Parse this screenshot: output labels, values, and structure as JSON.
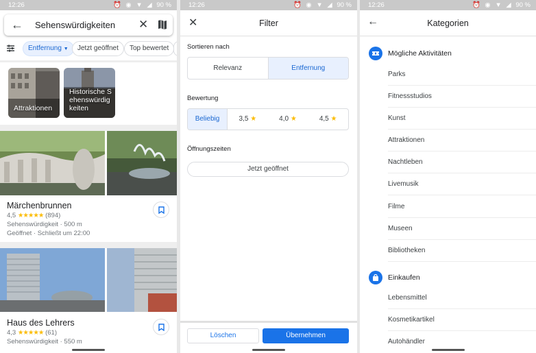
{
  "status": {
    "time": "12:26",
    "battery": "90 %"
  },
  "colors": {
    "accent": "#1a73e8",
    "chip_active_bg": "#e8f0fe",
    "star": "#fbbc04"
  },
  "search": {
    "query": "Sehenswürdigkeiten",
    "back_icon": "arrow-back-icon",
    "clear_icon": "close-icon",
    "map_icon": "map-icon"
  },
  "chips": [
    {
      "label": "Entfernung",
      "active": true
    },
    {
      "label": "Jetzt geöffnet",
      "active": false
    },
    {
      "label": "Top bewertet",
      "active": false
    }
  ],
  "categories": [
    {
      "label": "Attraktionen"
    },
    {
      "label": "Historische Sehenswürdigkeiten"
    }
  ],
  "results": [
    {
      "name": "Märchenbrunnen",
      "rating": "4,5",
      "stars": "★★★★★",
      "reviews": "(894)",
      "type_distance": "Sehenswürdigkeit · 500 m",
      "hours": "Geöffnet · Schließt um 22:00"
    },
    {
      "name": "Haus des Lehrers",
      "rating": "4,3",
      "stars": "★★★★★",
      "reviews": "(61)",
      "type_distance": "Sehenswürdigkeit · 550 m"
    }
  ],
  "filter": {
    "title": "Filter",
    "sort_label": "Sortieren nach",
    "sort_options": [
      "Relevanz",
      "Entfernung"
    ],
    "sort_selected": "Entfernung",
    "rating_label": "Bewertung",
    "rating_options": [
      "Beliebig",
      "3,5",
      "4,0",
      "4,5"
    ],
    "rating_selected": "Beliebig",
    "hours_label": "Öffnungszeiten",
    "hours_button": "Jetzt geöffnet",
    "clear_button": "Löschen",
    "apply_button": "Übernehmen"
  },
  "kategorien": {
    "title": "Kategorien",
    "groups": [
      {
        "label": "Mögliche Aktivitäten",
        "icon": "ticket-icon",
        "items": [
          "Parks",
          "Fitnessstudios",
          "Kunst",
          "Attraktionen",
          "Nachtleben",
          "Livemusik",
          "Filme",
          "Museen",
          "Bibliotheken"
        ]
      },
      {
        "label": "Einkaufen",
        "icon": "shopping-bag-icon",
        "items": [
          "Lebensmittel",
          "Kosmetikartikel",
          "Autohändler"
        ]
      }
    ]
  }
}
